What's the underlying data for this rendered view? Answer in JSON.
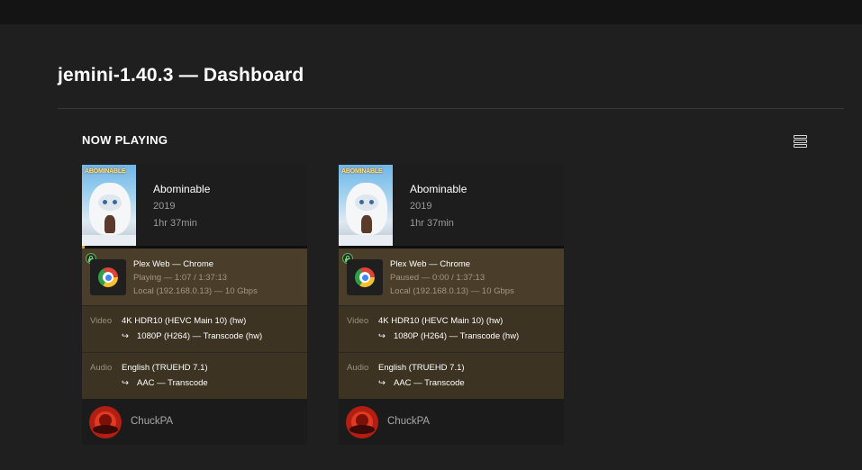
{
  "page": {
    "title": "jemini-1.40.3 — Dashboard",
    "section_title": "NOW PLAYING",
    "view_toggle_icon": "list-view-icon"
  },
  "colors": {
    "background": "#1f1f1f",
    "accent": "#e5a00d",
    "player_panel": "#4a3d2a",
    "stream_panel": "#3d3322",
    "secure_green": "#4fb34f"
  },
  "sessions": [
    {
      "title": "Abominable",
      "year": "2019",
      "duration": "1hr 37min",
      "poster_title": "ABOMINABLE",
      "progress_fraction": 0.012,
      "secure_icon": "lock-icon",
      "player_icon": "chrome-icon",
      "player_name": "Plex Web  —  Chrome",
      "player_state": "Playing — 1:07 / 1:37:13",
      "player_address": "Local (192.168.0.13) — 10 Gbps",
      "video_label": "Video",
      "video_source": "4K HDR10 (HEVC Main 10) (hw)",
      "video_arrow": "↪",
      "video_target": "1080P (H264) — Transcode (hw)",
      "audio_label": "Audio",
      "audio_source": "English (TRUEHD 7.1)",
      "audio_arrow": "↪",
      "audio_target": "AAC — Transcode",
      "user_avatar_icon": "user-avatar-icon",
      "user_name": "ChuckPA"
    },
    {
      "title": "Abominable",
      "year": "2019",
      "duration": "1hr 37min",
      "poster_title": "ABOMINABLE",
      "progress_fraction": 0,
      "secure_icon": "lock-icon",
      "player_icon": "chrome-icon",
      "player_name": "Plex Web  —  Chrome",
      "player_state": "Paused — 0:00 / 1:37:13",
      "player_address": "Local (192.168.0.13) — 10 Gbps",
      "video_label": "Video",
      "video_source": "4K HDR10 (HEVC Main 10) (hw)",
      "video_arrow": "↪",
      "video_target": "1080P (H264) — Transcode (hw)",
      "audio_label": "Audio",
      "audio_source": "English (TRUEHD 7.1)",
      "audio_arrow": "↪",
      "audio_target": "AAC — Transcode",
      "user_avatar_icon": "user-avatar-icon",
      "user_name": "ChuckPA"
    }
  ]
}
